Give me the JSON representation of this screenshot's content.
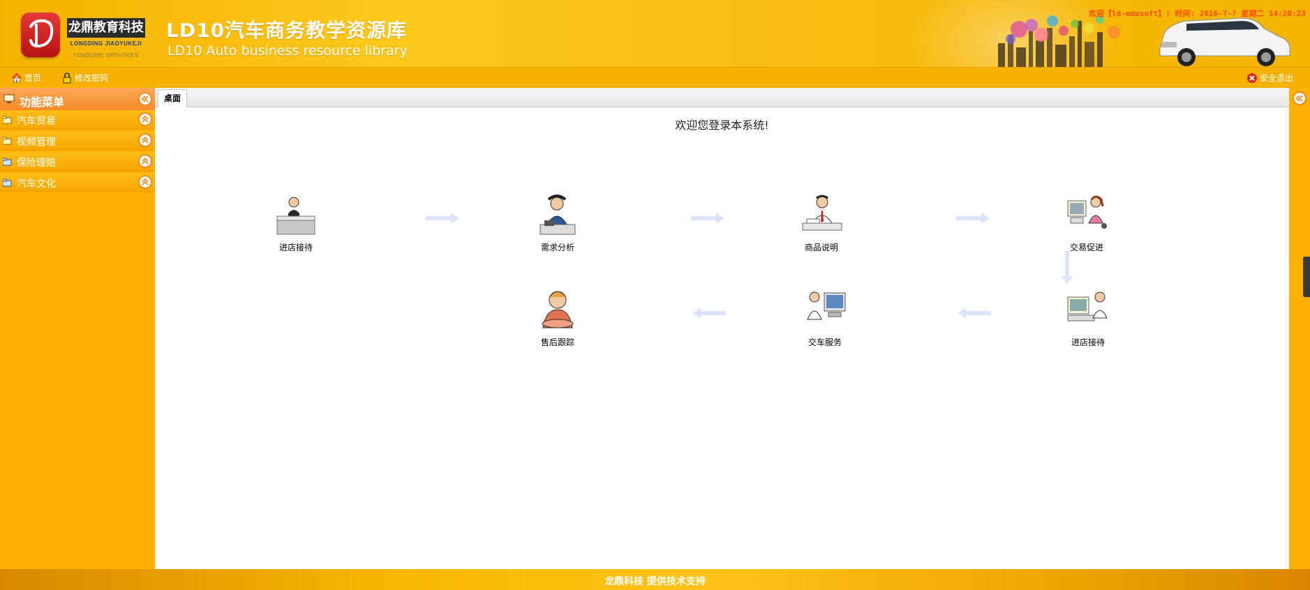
{
  "header": {
    "logo_cn": "龙鼎教育科技",
    "logo_en": "LONGDING JIAOYUKEJI",
    "title_cn": "LD10汽车商务教学资源库",
    "title_en": "LD10 Auto business resource library",
    "welcome": "欢迎【ld-edusoft】! 时间: 2016-7-? 星期二 14:20:23"
  },
  "toolbar": {
    "home_label": "首页",
    "change_password_label": "修改密码",
    "logout_label": "安全退出"
  },
  "sidebar": {
    "title": "功能菜单",
    "items": [
      {
        "label": "汽车贸易"
      },
      {
        "label": "视频管理"
      },
      {
        "label": "保险理赔"
      },
      {
        "label": "汽车文化"
      }
    ]
  },
  "tabs": [
    {
      "label": "桌面"
    }
  ],
  "main": {
    "welcome_heading": "欢迎您登录本系统!",
    "flow": [
      {
        "label": "进店接待",
        "icon": "receptionist-icon"
      },
      {
        "label": "需求分析",
        "icon": "phone-call-icon"
      },
      {
        "label": "商品说明",
        "icon": "presenter-icon"
      },
      {
        "label": "交易促进",
        "icon": "computer-worker-icon"
      },
      {
        "label": "进店接待",
        "icon": "computer-desk-icon"
      },
      {
        "label": "交车服务",
        "icon": "car-handover-icon"
      },
      {
        "label": "售后跟踪",
        "icon": "call-center-icon"
      }
    ]
  },
  "footer": {
    "text": "龙鼎科技 提供技术支持"
  },
  "colors": {
    "brand_yellow": "#f8b800",
    "sidebar_head": "#f58a28",
    "arrow": "#dde3fb",
    "welcome_text": "#ff4a00"
  }
}
